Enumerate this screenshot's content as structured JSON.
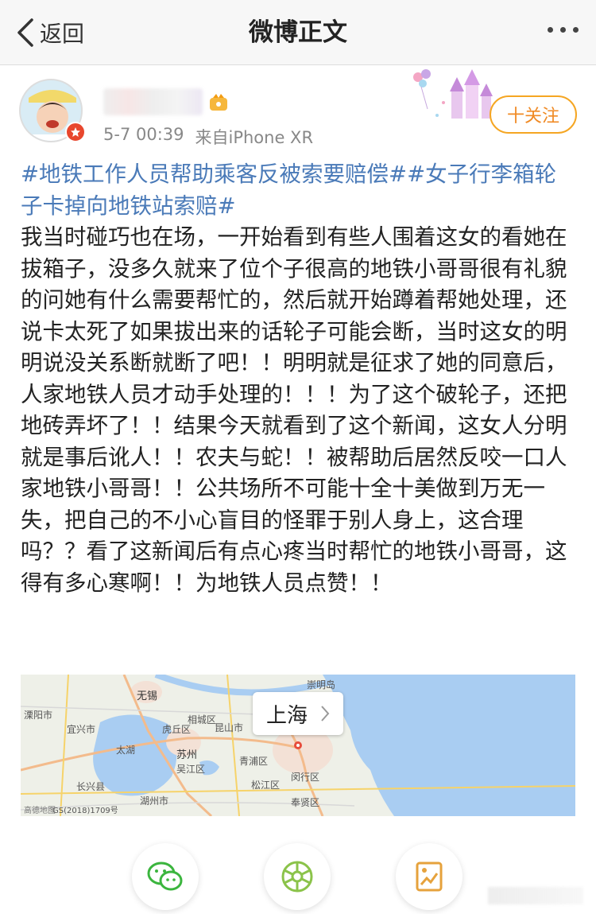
{
  "nav": {
    "back_label": "返回",
    "title": "微博正文"
  },
  "post": {
    "time": "5-7 00:39",
    "source": "来自iPhone XR",
    "follow_label": "十关注",
    "hashtag_1": "#地铁工作人员帮助乘客反被索要赔偿#",
    "hashtag_2": "#女子行李箱轮子卡掉向地铁站索赔#",
    "body_text": "我当时碰巧也在场，一开始看到有些人围着这女的看她在拔箱子，没多久就来了位个子很高的地铁小哥哥很有礼貌的问她有什么需要帮忙的，然后就开始蹲着帮她处理，还说卡太死了如果拔出来的话轮子可能会断，当时这女的明明说没关系断就断了吧！！明明就是征求了她的同意后，人家地铁人员才动手处理的！！！为了这个破轮子，还把地砖弄坏了！！结果今天就看到了这个新闻，这女人分明就是事后讹人！！农夫与蛇！！被帮助后居然反咬一口人家地铁小哥哥！！公共场所不可能十全十美做到万无一失，把自己的不小心盲目的怪罪于别人身上，这合理吗？？看了这新闻后有点心疼当时帮忙的地铁小哥哥，这得有多心寒啊！！为地铁人员点赞！！"
  },
  "map": {
    "popup_label": "上海",
    "labels": {
      "chongming": "崇明岛",
      "liyang": "溧阳市",
      "wuxi": "无锡",
      "yixing": "宜兴市",
      "huqiu": "虎丘区",
      "xiangcheng": "相城区",
      "kunshan": "昆山市",
      "taihu": "太湖",
      "suzhou": "苏州",
      "wuzhong": "吴江区",
      "qingpu": "青浦区",
      "minhang": "闵行区",
      "songjiang": "松江区",
      "fengxian": "奉贤区",
      "changxing": "长兴县",
      "huzhou": "湖州市",
      "license": "GS(2018)1709号",
      "brand": "高德地图"
    }
  },
  "share": {
    "items": [
      "wechat-icon",
      "moments-icon",
      "save-image-icon"
    ]
  },
  "colors": {
    "hashtag": "#4a7ab8",
    "follow": "#f08a24",
    "wechat": "#3bb53e",
    "moments": "#8bc34a",
    "save": "#e6a23c"
  }
}
